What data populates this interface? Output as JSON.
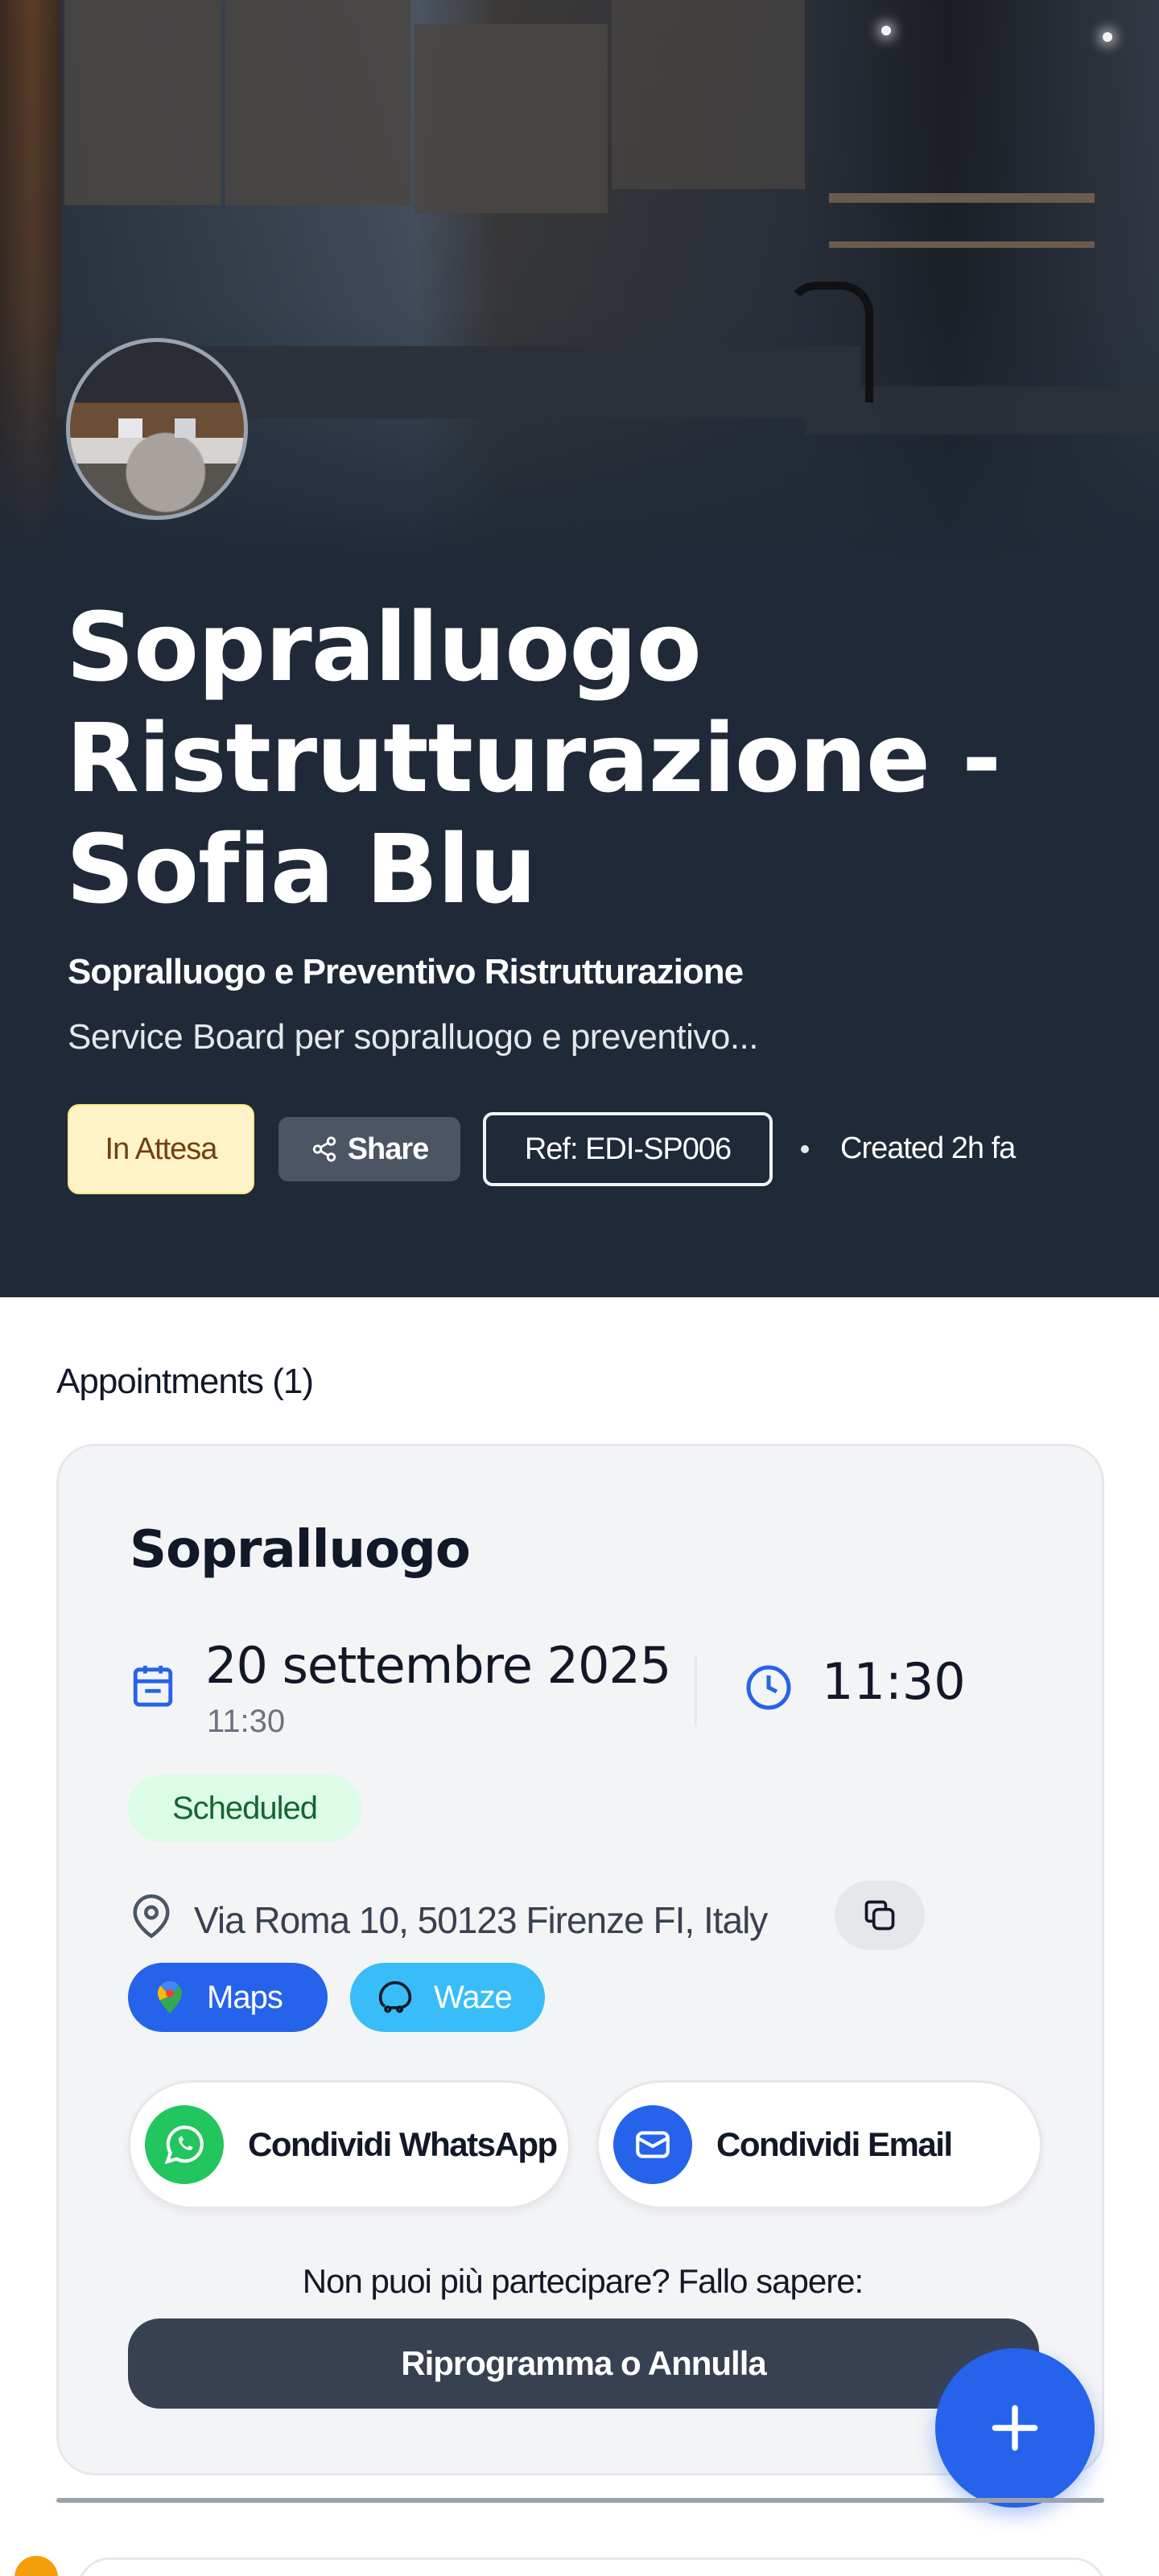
{
  "hero": {
    "title": "Sopralluogo Ristrutturazione - Sofia Blu",
    "subtitle": "Sopralluogo e Preventivo Ristrutturazione",
    "description": "Service Board per sopralluogo e preventivo...",
    "status_badge": "In Attesa",
    "share_label": "Share",
    "reference": "Ref: EDI-SP006",
    "created": "Created 2h fa"
  },
  "appointments": {
    "heading": "Appointments (1)",
    "items": [
      {
        "title": "Sopralluogo",
        "date": "20 settembre 2025",
        "date_time_small": "11:30",
        "time": "11:30",
        "status": "Scheduled",
        "address": "Via Roma 10, 50123 Firenze FI, Italy",
        "maps_label": "Maps",
        "waze_label": "Waze",
        "share_whatsapp_label": "Condividi WhatsApp",
        "share_email_label": "Condividi Email",
        "cant_attend_text": "Non puoi più partecipare? Fallo sapere:",
        "reschedule_label": "Riprogramma o Annulla"
      }
    ]
  },
  "colors": {
    "hero_bg": "#1f2937",
    "accent": "#2563eb",
    "status_pending_bg": "#fef3c7",
    "status_scheduled_bg": "#dcfce7",
    "whatsapp": "#22c55e",
    "waze": "#38bdf8",
    "dark_button": "#374151"
  },
  "icons": {
    "share": "share-icon",
    "calendar": "calendar-icon",
    "clock": "clock-icon",
    "location": "map-pin-icon",
    "copy": "copy-icon",
    "maps": "google-maps-icon",
    "waze": "waze-icon",
    "whatsapp": "whatsapp-icon",
    "email": "email-icon",
    "fab": "plus-icon"
  }
}
